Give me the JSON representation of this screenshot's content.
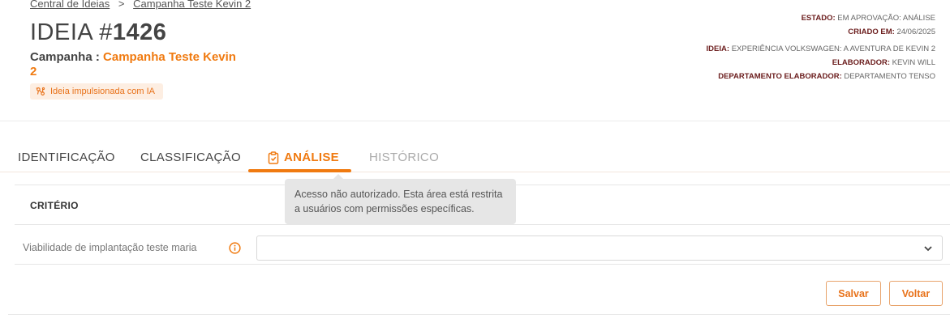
{
  "breadcrumb": {
    "root": "Central de Ideias",
    "separator": ">",
    "current": "Campanha Teste Kevin 2"
  },
  "idea": {
    "prefix": "IDEIA #",
    "number": "1426"
  },
  "campaign": {
    "label": "Campanha :",
    "name": "Campanha Teste Kevin 2"
  },
  "ai_badge": {
    "label": "Ideia impulsionada com IA",
    "icon": "ai-sparkle-icon"
  },
  "meta": {
    "estado": {
      "key": "ESTADO:",
      "value": "EM APROVAÇÃO: ANÁLISE"
    },
    "criado": {
      "key": "CRIADO EM:",
      "value": "24/06/2025"
    },
    "ideia": {
      "key": "IDEIA:",
      "value": "EXPERIÊNCIA VOLKSWAGEN: A AVENTURA DE KEVIN 2"
    },
    "elaborador": {
      "key": "ELABORADOR:",
      "value": "KEVIN WILL"
    },
    "departamento": {
      "key": "DEPARTAMENTO ELABORADOR:",
      "value": "DEPARTAMENTO TENSO"
    }
  },
  "tabs": [
    {
      "label": "IDENTIFICAÇÃO"
    },
    {
      "label": "CLASSIFICAÇÃO"
    },
    {
      "label": "ANÁLISE",
      "icon": "clipboard-check-icon",
      "active": true
    },
    {
      "label": "HISTÓRICO",
      "disabled": true
    }
  ],
  "tooltip": {
    "text": "Acesso não autorizado. Esta área está restrita a usuários com permissões específicas."
  },
  "criteria": {
    "header": "CRITÉRIO",
    "rows": [
      {
        "label": "Viabilidade de implantação teste maria",
        "value": ""
      }
    ]
  },
  "actions": {
    "save": "Salvar",
    "back": "Voltar"
  },
  "colors": {
    "accent": "#f07a10",
    "meta_key": "#6b1d1d",
    "tooltip_bg": "#e6e6e6"
  }
}
